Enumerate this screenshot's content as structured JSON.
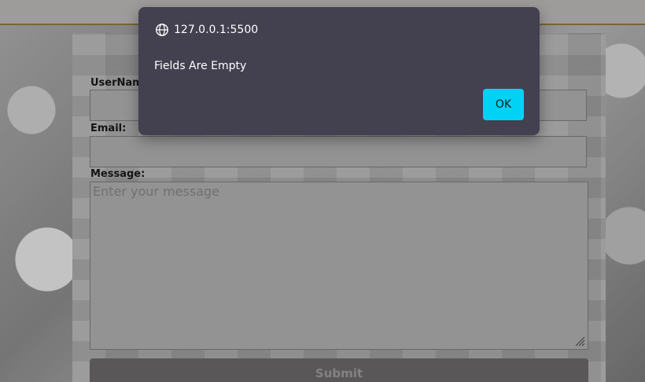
{
  "dialog": {
    "origin": "127.0.0.1:5500",
    "message": "Fields Are Empty",
    "ok_label": "OK",
    "accent": "#00d2f5",
    "background": "#434050"
  },
  "form": {
    "username_label": "UserName:",
    "email_label": "Email:",
    "message_label": "Message:",
    "message_placeholder": "Enter your message",
    "submit_label": "Submit"
  },
  "icons": {
    "origin_icon": "globe-icon",
    "resize_icon": "resize-grip-icon"
  }
}
